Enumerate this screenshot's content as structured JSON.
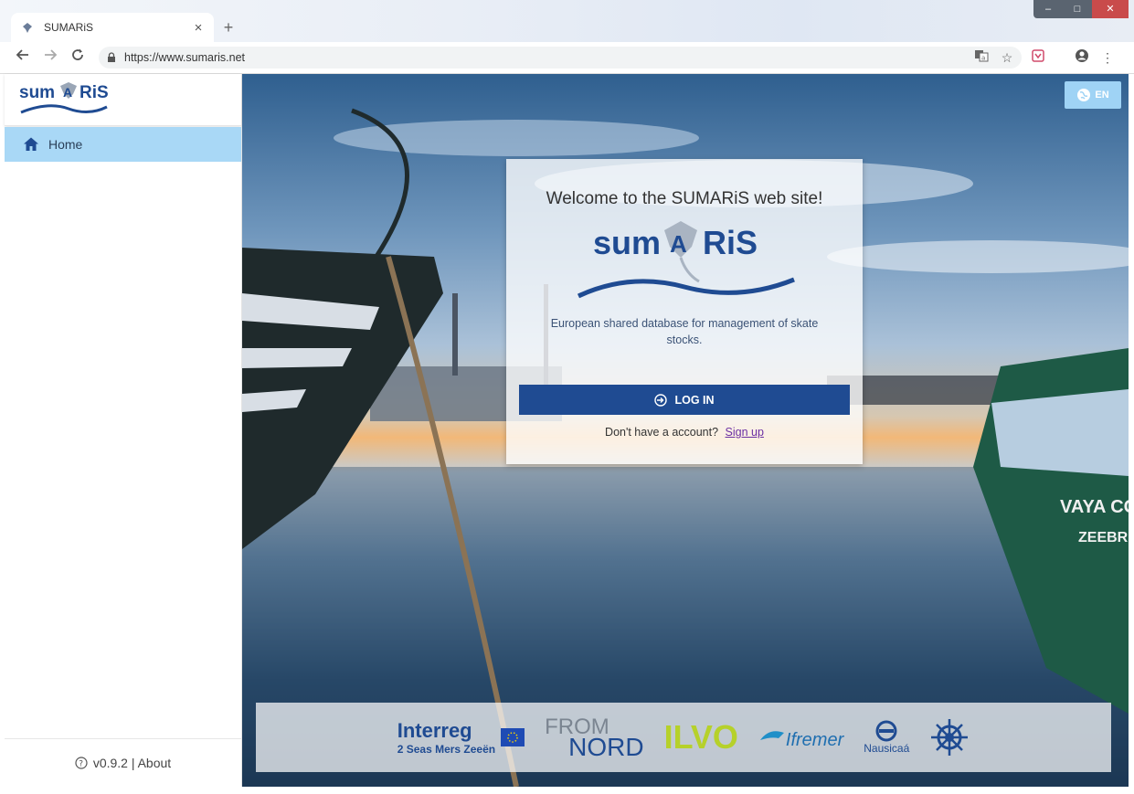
{
  "browser": {
    "tab_title": "SUMARiS",
    "tab_close": "×",
    "new_tab": "+",
    "url": "https://www.sumaris.net",
    "window_controls": [
      "–",
      "□",
      "✕"
    ]
  },
  "sidebar": {
    "logo_alt": "sumaris",
    "items": [
      {
        "label": "Home",
        "icon": "home-icon",
        "active": true
      }
    ],
    "footer": "v0.9.2 | About"
  },
  "header": {
    "language": "EN"
  },
  "card": {
    "title": "Welcome to the SUMARiS web site!",
    "description": "European shared database for management of skate stocks.",
    "login_label": "LOG IN",
    "signup_prompt": "Don't have a account?",
    "signup_link": "Sign up"
  },
  "partners": {
    "interreg_1": "Interreg",
    "interreg_2": "2 Seas Mers Zeeën",
    "fromnord_1": "FROM",
    "fromnord_2": "NORD",
    "ilvo": "ILVO",
    "ifremer": "Ifremer",
    "nausicaa": "Nausicaá"
  },
  "colors": {
    "brand": "#1f4b92",
    "sidebar_active": "#a9d8f6",
    "lang_button": "#9fd3f5",
    "signup_link": "#6b2fa3"
  }
}
